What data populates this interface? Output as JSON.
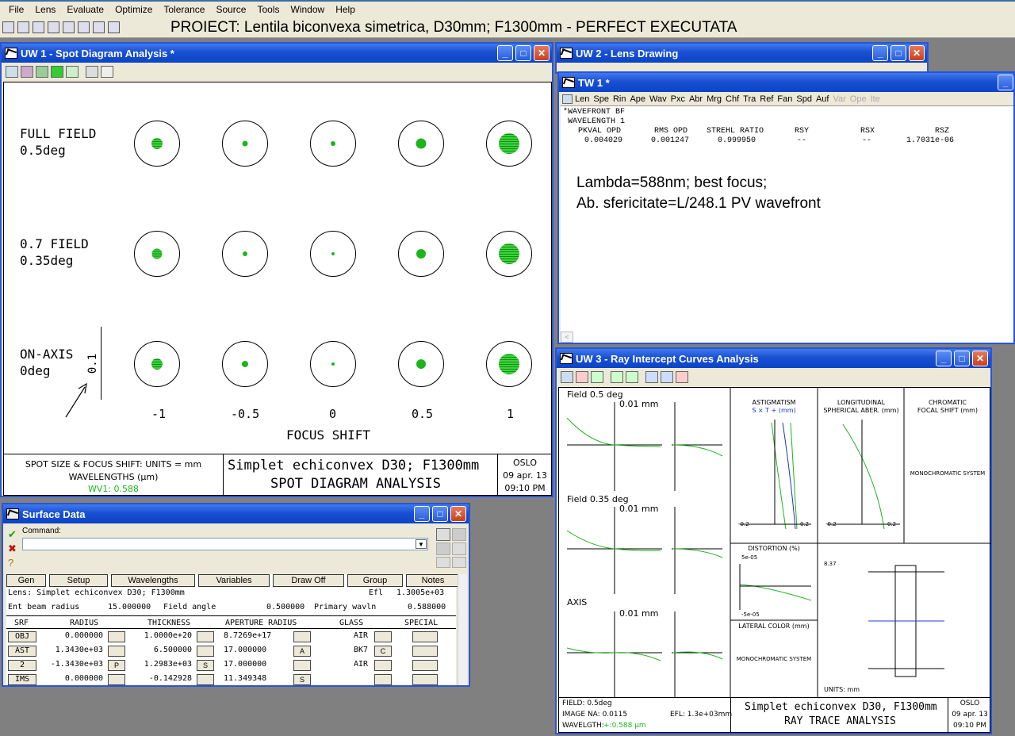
{
  "menu": [
    "File",
    "Lens",
    "Evaluate",
    "Optimize",
    "Tolerance",
    "Source",
    "Tools",
    "Window",
    "Help"
  ],
  "project_title": "PROIECT: Lentila biconvexa simetrica, D30mm; F1300mm - PERFECT EXECUTATA",
  "uw1": {
    "title": "UW 1 - Spot Diagram Analysis *",
    "rows": [
      {
        "l1": "FULL FIELD",
        "l2": "0.5deg"
      },
      {
        "l1": "0.7 FIELD",
        "l2": "0.35deg"
      },
      {
        "l1": "ON-AXIS",
        "l2": "0deg"
      }
    ],
    "scale": "0.1",
    "shifts": [
      "-1",
      "-0.5",
      "0",
      "0.5",
      "1"
    ],
    "xlabel": "FOCUS SHIFT",
    "footer_units": "SPOT SIZE & FOCUS SHIFT: UNITS = mm",
    "footer_wl": "WAVELENGTHS (µm)",
    "footer_wv": "WV1: 0.588",
    "footer_title1": "Simplet echiconvex D30; F1300mm",
    "footer_title2": "SPOT DIAGRAM ANALYSIS",
    "oslo": "OSLO",
    "date": "09 apr. 13",
    "time": "09:10 PM"
  },
  "uw2": {
    "title": "UW 2 - Lens Drawing"
  },
  "tw1": {
    "title": "TW 1 *",
    "menu": [
      "Len",
      "Spe",
      "Rin",
      "Ape",
      "Wav",
      "Pxc",
      "Abr",
      "Mrg",
      "Chf",
      "Tra",
      "Ref",
      "Fan",
      "Spd",
      "Auf"
    ],
    "menu_disabled": [
      "Var",
      "Ope",
      "Ite"
    ],
    "line1": "*WAVEFRONT BF",
    "line2": " WAVELENGTH 1",
    "headers": [
      "PKVAL OPD",
      "RMS OPD",
      "STREHL RATIO",
      "RSY",
      "RSX",
      "RSZ"
    ],
    "values": [
      "0.004029",
      "0.001247",
      "0.999950",
      "--",
      "--",
      "1.7031e-06"
    ],
    "note1": "Lambda=588nm; best focus;",
    "note2": "Ab. sfericitate=L/248.1 PV wavefront"
  },
  "uw3": {
    "title": "UW 3 - Ray Intercept Curves Analysis",
    "fields": [
      "Field 0.5 deg",
      "Field 0.35 deg",
      "AXIS"
    ],
    "scale": "0.01 mm",
    "astig_title": "ASTIGMATISM",
    "astig_sub": "S × T + (mm)",
    "long_title": "LONGITUDINAL",
    "long_sub": "SPHERICAL ABER. (mm)",
    "chrom_title": "CHROMATIC",
    "chrom_sub": "FOCAL SHIFT (mm)",
    "mono": "MONOCHROMATIC SYSTEM",
    "tick_neg": "-0.2",
    "tick_pos": "0.2",
    "dist_title": "DISTORTION (%)",
    "dist_top": "5e-05",
    "dist_bot": "-5e-05",
    "lat_title": "LATERAL COLOR (mm)",
    "lens_scale": "8.37",
    "units": "UNITS: mm",
    "foot_field": "FIELD: 0.5deg",
    "foot_na": "IMAGE NA: 0.0115",
    "foot_wl": "WAVELGTH:",
    "foot_wl_val": "+:0.588 µm",
    "foot_efl": "EFL: 1.3e+03mm",
    "foot_t1": "Simplet echiconvex D30, F1300mm",
    "foot_t2": "RAY TRACE ANALYSIS",
    "oslo": "OSLO",
    "date": "09 apr. 13",
    "time": "09:10 PM"
  },
  "surface": {
    "title": "Surface Data",
    "command_label": "Command:",
    "buttons": [
      "Gen",
      "Setup",
      "Wavelengths",
      "Variables",
      "Draw Off",
      "Group",
      "Notes"
    ],
    "lens_label": "Lens: Simplet echiconvex D30; F1300mm",
    "efl_label": "Efl",
    "efl": "1.3005e+03",
    "ebr_label": "Ent beam radius",
    "ebr": "15.000000",
    "fa_label": "Field angle",
    "fa": "0.500000",
    "pw_label": "Primary wavln",
    "pw": "0.588000",
    "cols": [
      "SRF",
      "RADIUS",
      "THICKNESS",
      "APERTURE RADIUS",
      "GLASS",
      "SPECIAL"
    ],
    "rows": [
      {
        "srf": "OBJ",
        "radius": "0.000000",
        "rb": "",
        "thick": "1.0000e+20",
        "tb": "",
        "ap": "8.7269e+17",
        "ab": "",
        "glass": "AIR",
        "gb": ""
      },
      {
        "srf": "AST",
        "radius": "1.3430e+03",
        "rb": "",
        "thick": "6.500000",
        "tb": "",
        "ap": "17.000000",
        "ab": "A",
        "glass": "BK7",
        "gb": "C"
      },
      {
        "srf": "2",
        "radius": "-1.3430e+03",
        "rb": "P",
        "thick": "1.2983e+03",
        "tb": "S",
        "ap": "17.000000",
        "ab": "",
        "glass": "AIR",
        "gb": ""
      },
      {
        "srf": "IMS",
        "radius": "0.000000",
        "rb": "",
        "thick": "-0.142928",
        "tb": "",
        "ap": "11.349348",
        "ab": "S",
        "glass": "",
        "gb": ""
      }
    ]
  }
}
